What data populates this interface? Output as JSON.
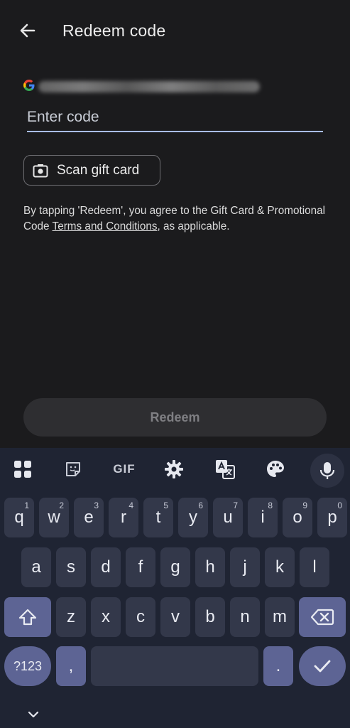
{
  "header": {
    "title": "Redeem code"
  },
  "account": {
    "logo": "G"
  },
  "code_input": {
    "placeholder": "Enter code",
    "value": ""
  },
  "scan_button": {
    "label": "Scan gift card"
  },
  "terms": {
    "prefix": "By tapping 'Redeem', you agree to the Gift Card & Promotional Code ",
    "link": "Terms and Conditions",
    "suffix": ", as applicable."
  },
  "redeem_button": {
    "label": "Redeem"
  },
  "keyboard": {
    "toolbar": {
      "gif_label": "GIF"
    },
    "row1": [
      {
        "char": "q",
        "hint": "1"
      },
      {
        "char": "w",
        "hint": "2"
      },
      {
        "char": "e",
        "hint": "3"
      },
      {
        "char": "r",
        "hint": "4"
      },
      {
        "char": "t",
        "hint": "5"
      },
      {
        "char": "y",
        "hint": "6"
      },
      {
        "char": "u",
        "hint": "7"
      },
      {
        "char": "i",
        "hint": "8"
      },
      {
        "char": "o",
        "hint": "9"
      },
      {
        "char": "p",
        "hint": "0"
      }
    ],
    "row2": [
      "a",
      "s",
      "d",
      "f",
      "g",
      "h",
      "j",
      "k",
      "l"
    ],
    "row3": [
      "z",
      "x",
      "c",
      "v",
      "b",
      "n",
      "m"
    ],
    "row4": {
      "symbols": "?123",
      "comma": ",",
      "period": "."
    }
  }
}
